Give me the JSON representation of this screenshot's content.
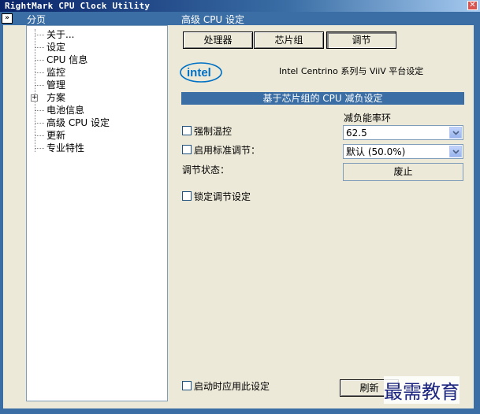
{
  "window": {
    "title": "RightMark CPU Clock Utility",
    "close_glyph": "✕"
  },
  "sidebar": {
    "collapse_glyph": "»",
    "title": "分页",
    "items": [
      {
        "label": "关于..."
      },
      {
        "label": "设定"
      },
      {
        "label": "CPU 信息"
      },
      {
        "label": "监控"
      },
      {
        "label": "管理"
      },
      {
        "label": "方案",
        "expandable": true,
        "expander": "+"
      },
      {
        "label": "电池信息"
      },
      {
        "label": "高级 CPU 设定",
        "selected": true
      },
      {
        "label": "更新"
      },
      {
        "label": "专业特性"
      }
    ]
  },
  "main": {
    "title": "高级 CPU 设定",
    "tabs": [
      {
        "label": "处理器"
      },
      {
        "label": "芯片组"
      },
      {
        "label": "调节",
        "active": true
      }
    ],
    "logo_text": "intel",
    "platform_text": "Intel Centrino 系列与 ViiV 平台设定",
    "section_title": "基于芯片组的 CPU 减负设定",
    "duty_cycle_label": "减负能率环",
    "thermal_control": {
      "label": "强制温控",
      "checked": false,
      "value": "62.5"
    },
    "standard_throttle": {
      "label": "启用标准调节：",
      "checked": false,
      "value": "默认 (50.0%)"
    },
    "throttle_status": {
      "label": "调节状态：",
      "value": "废止"
    },
    "lock_throttle": {
      "label": "锁定调节设定",
      "checked": false
    },
    "apply_on_startup": {
      "label": "启动时应用此设定",
      "checked": false
    },
    "refresh_label": "刷新"
  },
  "watermark": "最需教育",
  "colors": {
    "title_bar": "#0A246A",
    "header_blue": "#3A6EA5",
    "panel": "#ECE9D8",
    "intel_blue": "#0071C5"
  }
}
